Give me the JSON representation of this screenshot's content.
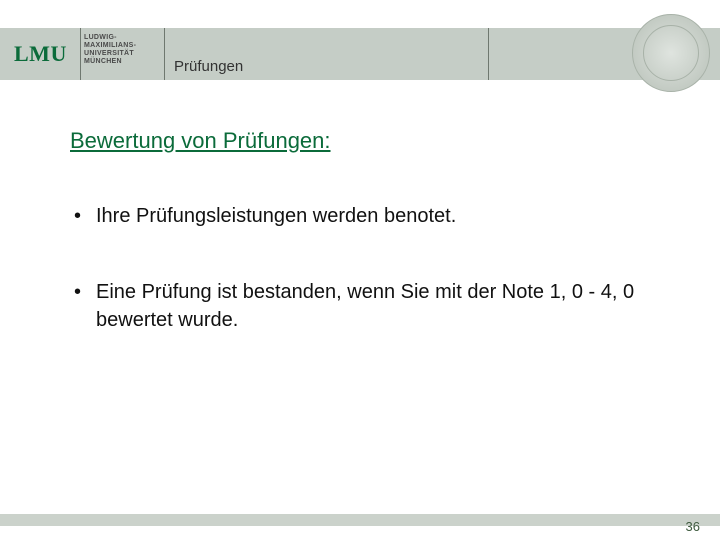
{
  "header": {
    "logo_text": "LMU",
    "logo_subtext_line1": "LUDWIG-",
    "logo_subtext_line2": "MAXIMILIANS-",
    "logo_subtext_line3": "UNIVERSITÄT",
    "logo_subtext_line4": "MÜNCHEN",
    "title": "Prüfungen"
  },
  "content": {
    "title": "Bewertung von Prüfungen:",
    "bullets": [
      "Ihre Prüfungsleistungen werden benotet.",
      "Eine Prüfung ist bestanden, wenn Sie mit der Note 1, 0 - 4, 0 bewertet wurde."
    ]
  },
  "footer": {
    "page_number": "36"
  }
}
